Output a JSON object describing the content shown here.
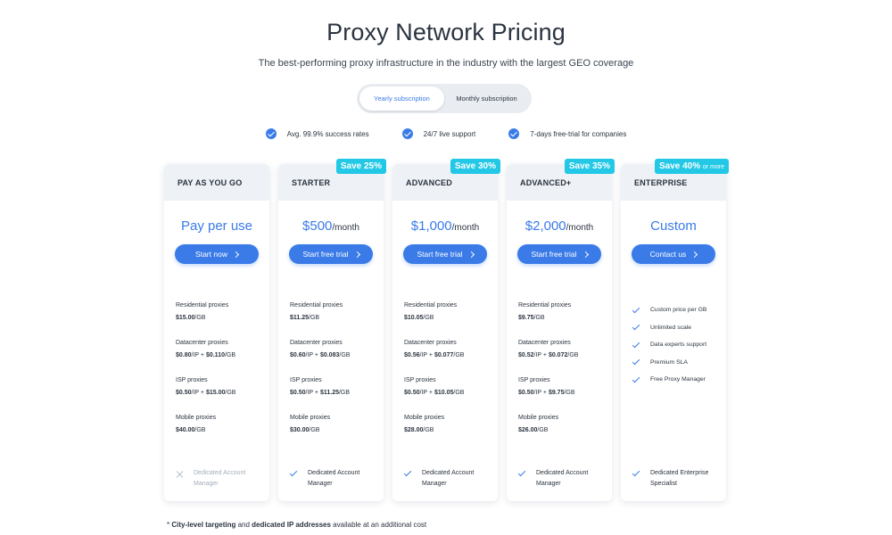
{
  "title": "Proxy Network Pricing",
  "subtitle": "The best-performing proxy infrastructure in the industry with the largest GEO coverage",
  "toggle": {
    "yearly": "Yearly subscription",
    "monthly": "Monthly subscription",
    "active": "yearly"
  },
  "features": [
    "Avg. 99.9% success rates",
    "24/7 live support",
    "7-days free-trial for companies"
  ],
  "plans": [
    {
      "name": "PAY AS YOU GO",
      "badge": "",
      "price": "Pay per use",
      "per": "",
      "cta": "Start now",
      "items": [
        {
          "label": "Residential proxies",
          "value": "$15.00",
          "unit": "/GB"
        },
        {
          "label": "Datacenter proxies",
          "v1": "$0.80",
          "u1": "/IP + ",
          "v2": "$0.110",
          "u2": "/GB"
        },
        {
          "label": "ISP proxies",
          "v1": "$0.50",
          "u1": "/IP + ",
          "v2": "$15.00",
          "u2": "/GB"
        },
        {
          "label": "Mobile proxies",
          "value": "$40.00",
          "unit": "/GB"
        }
      ],
      "footer": "Dedicated Account Manager",
      "footer_included": false
    },
    {
      "name": "STARTER",
      "badge": "Save 25%",
      "price": "$500",
      "per": "/month",
      "cta": "Start free trial",
      "items": [
        {
          "label": "Residential proxies",
          "value": "$11.25",
          "unit": "/GB"
        },
        {
          "label": "Datacenter proxies",
          "v1": "$0.60",
          "u1": "/IP + ",
          "v2": "$0.083",
          "u2": "/GB"
        },
        {
          "label": "ISP proxies",
          "v1": "$0.50",
          "u1": "/IP + ",
          "v2": "$11.25",
          "u2": "/GB"
        },
        {
          "label": "Mobile proxies",
          "value": "$30.00",
          "unit": "/GB"
        }
      ],
      "footer": "Dedicated Account Manager",
      "footer_included": true
    },
    {
      "name": "ADVANCED",
      "badge": "Save 30%",
      "price": "$1,000",
      "per": "/month",
      "cta": "Start free trial",
      "items": [
        {
          "label": "Residential proxies",
          "value": "$10.05",
          "unit": "/GB"
        },
        {
          "label": "Datacenter proxies",
          "v1": "$0.56",
          "u1": "/IP + ",
          "v2": "$0.077",
          "u2": "/GB"
        },
        {
          "label": "ISP proxies",
          "v1": "$0.50",
          "u1": "/IP + ",
          "v2": "$10.05",
          "u2": "/GB"
        },
        {
          "label": "Mobile proxies",
          "value": "$28.00",
          "unit": "/GB"
        }
      ],
      "footer": "Dedicated Account Manager",
      "footer_included": true
    },
    {
      "name": "ADVANCED+",
      "badge": "Save 35%",
      "price": "$2,000",
      "per": "/month",
      "cta": "Start free trial",
      "items": [
        {
          "label": "Residential proxies",
          "value": "$9.75",
          "unit": "/GB"
        },
        {
          "label": "Datacenter proxies",
          "v1": "$0.52",
          "u1": "/IP + ",
          "v2": "$0.072",
          "u2": "/GB"
        },
        {
          "label": "ISP proxies",
          "v1": "$0.50",
          "u1": "/IP + ",
          "v2": "$9.75",
          "u2": "/GB"
        },
        {
          "label": "Mobile proxies",
          "value": "$26.00",
          "unit": "/GB"
        }
      ],
      "footer": "Dedicated Account Manager",
      "footer_included": true
    },
    {
      "name": "ENTERPRISE",
      "badge": "Save 40%",
      "badge_suffix": "or more",
      "price": "Custom",
      "per": "",
      "cta": "Contact us",
      "perks": [
        "Custom price per GB",
        "Unlimited scale",
        "Data experts support",
        "Premium SLA",
        "Free Proxy Manager"
      ],
      "footer": "Dedicated Enterprise Specialist",
      "footer_included": true
    }
  ],
  "footnote": {
    "star": "* ",
    "b1": "City-level targeting",
    "t1": " and ",
    "b2": "dedicated IP addresses",
    "t2": " available at an additional cost"
  },
  "colors": {
    "accent": "#3a7be8",
    "badge": "#22c8e5",
    "header_bg": "#eef1f5"
  },
  "icons": {
    "feature": "check-circle-icon",
    "included": "check-icon",
    "excluded": "x-icon",
    "cta": "chevron-right-icon"
  }
}
